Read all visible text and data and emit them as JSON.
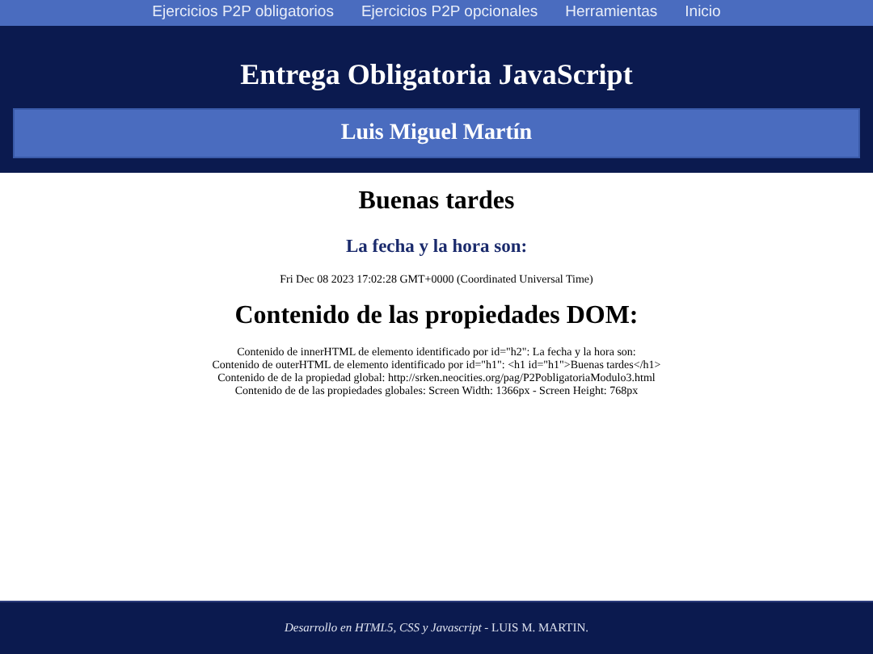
{
  "nav": {
    "links": [
      "Ejercicios P2P obligatorios",
      "Ejercicios P2P opcionales",
      "Herramientas",
      "Inicio"
    ]
  },
  "header": {
    "title": "Entrega Obligatoria JavaScript",
    "author": "Luis Miguel Martín"
  },
  "main": {
    "greeting": "Buenas tardes",
    "date_heading": "La fecha y la hora son:",
    "date": "Fri Dec 08 2023 17:02:28 GMT+0000 (Coordinated Universal Time)",
    "dom_heading": "Contenido de las propiedades DOM:",
    "dom_lines": [
      "Contenido de innerHTML de elemento identificado por id=\"h2\": La fecha y la hora son:",
      "Contenido de outerHTML de elemento identificado por id=\"h1\": <h1 id=\"h1\">Buenas tardes</h1>",
      "Contenido de de la propiedad global: http://srken.neocities.org/pag/P2PobligatoriaModulo3.html",
      "Contenido de de las propiedades globales: Screen Width: 1366px - Screen Height: 768px"
    ]
  },
  "footer": {
    "text": "*Desarrollo en HTML5, CSS y Javascript* - LUIS M. MARTIN."
  }
}
